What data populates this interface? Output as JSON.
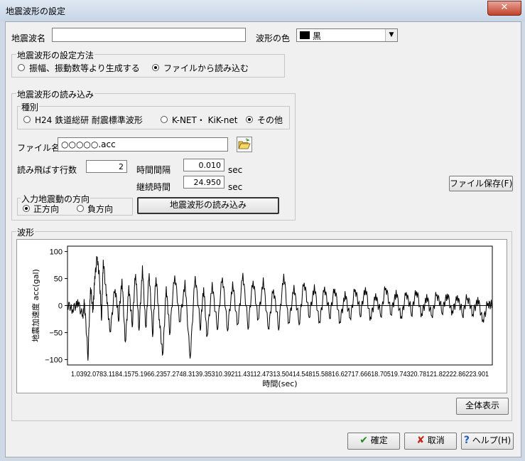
{
  "window": {
    "title": "地震波形の設定",
    "close_glyph": "✕"
  },
  "header": {
    "name_label": "地震波名",
    "name_value": "",
    "color_label": "波形の色",
    "color_value": "黒",
    "color_swatch": "#000000"
  },
  "method": {
    "title": "地震波形の設定方法",
    "opt_generate": "振幅、振動数等より生成する",
    "opt_file": "ファイルから読み込む"
  },
  "load": {
    "title": "地震波形の読み込み",
    "kind": {
      "title": "種別",
      "opt_h24": "H24 鉄道総研 耐震標準波形",
      "opt_knet": "K-NET・ KiK-net",
      "opt_other": "その他"
    },
    "file_label": "ファイル名",
    "file_value": "○○○○○.acc",
    "folder_icon": "folder-open-icon",
    "skip_label": "読み飛ばす行数",
    "skip_value": "2",
    "interval_label": "時間間隔",
    "interval_value": "0.010",
    "interval_unit": "sec",
    "duration_label": "継続時間",
    "duration_value": "24.950",
    "duration_unit": "sec",
    "direction": {
      "title": "入力地震動の方向",
      "opt_pos": "正方向",
      "opt_neg": "負方向"
    },
    "load_button": "地震波形の読み込み"
  },
  "save_button": "ファイル保存(F)",
  "waveform": {
    "title": "波形",
    "show_all_button": "全体表示"
  },
  "footer": {
    "ok": "確定",
    "cancel": "取消",
    "help": "ヘルプ(H)"
  },
  "chart_data": {
    "type": "line",
    "ylabel": "地震加速度 acc(gal)",
    "xlabel": "時間(sec)",
    "ylim": [
      -110,
      110
    ],
    "xlim": [
      0,
      24.95
    ],
    "yticks": [
      100,
      50,
      0,
      -50,
      -100
    ],
    "xtick_labels": "1.0392.0783.1184.1575.1966.2357.2748.3139.35310.39211.43112.47313.50414.54815.58816.62717.66618.70519.74320.78121.82222.86223.901",
    "series": [
      {
        "color": "#000000",
        "x": [
          0,
          0.3,
          0.6,
          0.9,
          1.0,
          1.2,
          1.35,
          1.5,
          1.6,
          1.75,
          1.9,
          2.0,
          2.1,
          2.3,
          2.5,
          2.8,
          3.0,
          3.2,
          3.4,
          3.6,
          3.8,
          4.0,
          4.2,
          4.4,
          4.6,
          4.8,
          5.0,
          5.2,
          5.4,
          5.6,
          5.8,
          6.0,
          6.3,
          6.6,
          6.9,
          7.2,
          7.5,
          7.8,
          8.0,
          8.2,
          8.5,
          8.8,
          9.1,
          9.4,
          9.7,
          10.0,
          10.3,
          10.6,
          10.9,
          11.2,
          11.5,
          11.8,
          12.1,
          12.4,
          12.7,
          13.0,
          13.3,
          13.6,
          13.9,
          14.2,
          14.5,
          14.8,
          15.1,
          15.4,
          15.7,
          16.0,
          16.3,
          16.6,
          16.9,
          17.2,
          17.5,
          17.8,
          18.1,
          18.4,
          18.7,
          19.0,
          19.3,
          19.6,
          19.9,
          20.2,
          20.5,
          20.8,
          21.1,
          21.4,
          21.7,
          22.0,
          22.3,
          22.6,
          22.9,
          23.2,
          23.5,
          23.8,
          24.1,
          24.4,
          24.7,
          24.95
        ],
        "y": [
          0,
          -12,
          8,
          -15,
          10,
          -100,
          30,
          -10,
          55,
          95,
          40,
          -30,
          80,
          20,
          -45,
          35,
          -30,
          45,
          -70,
          40,
          -35,
          60,
          -50,
          70,
          -40,
          65,
          -55,
          50,
          -30,
          -90,
          40,
          -50,
          55,
          -35,
          45,
          -95,
          60,
          -45,
          30,
          -60,
          45,
          -40,
          55,
          -50,
          40,
          -35,
          65,
          -40,
          45,
          -30,
          50,
          -40,
          35,
          -45,
          55,
          -35,
          40,
          -30,
          45,
          -25,
          35,
          -30,
          40,
          -20,
          30,
          -35,
          25,
          -20,
          35,
          -20,
          30,
          -25,
          25,
          -15,
          35,
          -20,
          25,
          -20,
          30,
          -15,
          25,
          -20,
          20,
          -15,
          25,
          -15,
          18,
          -12,
          22,
          -14,
          15,
          -20,
          12,
          -25,
          10,
          -5
        ]
      }
    ]
  }
}
